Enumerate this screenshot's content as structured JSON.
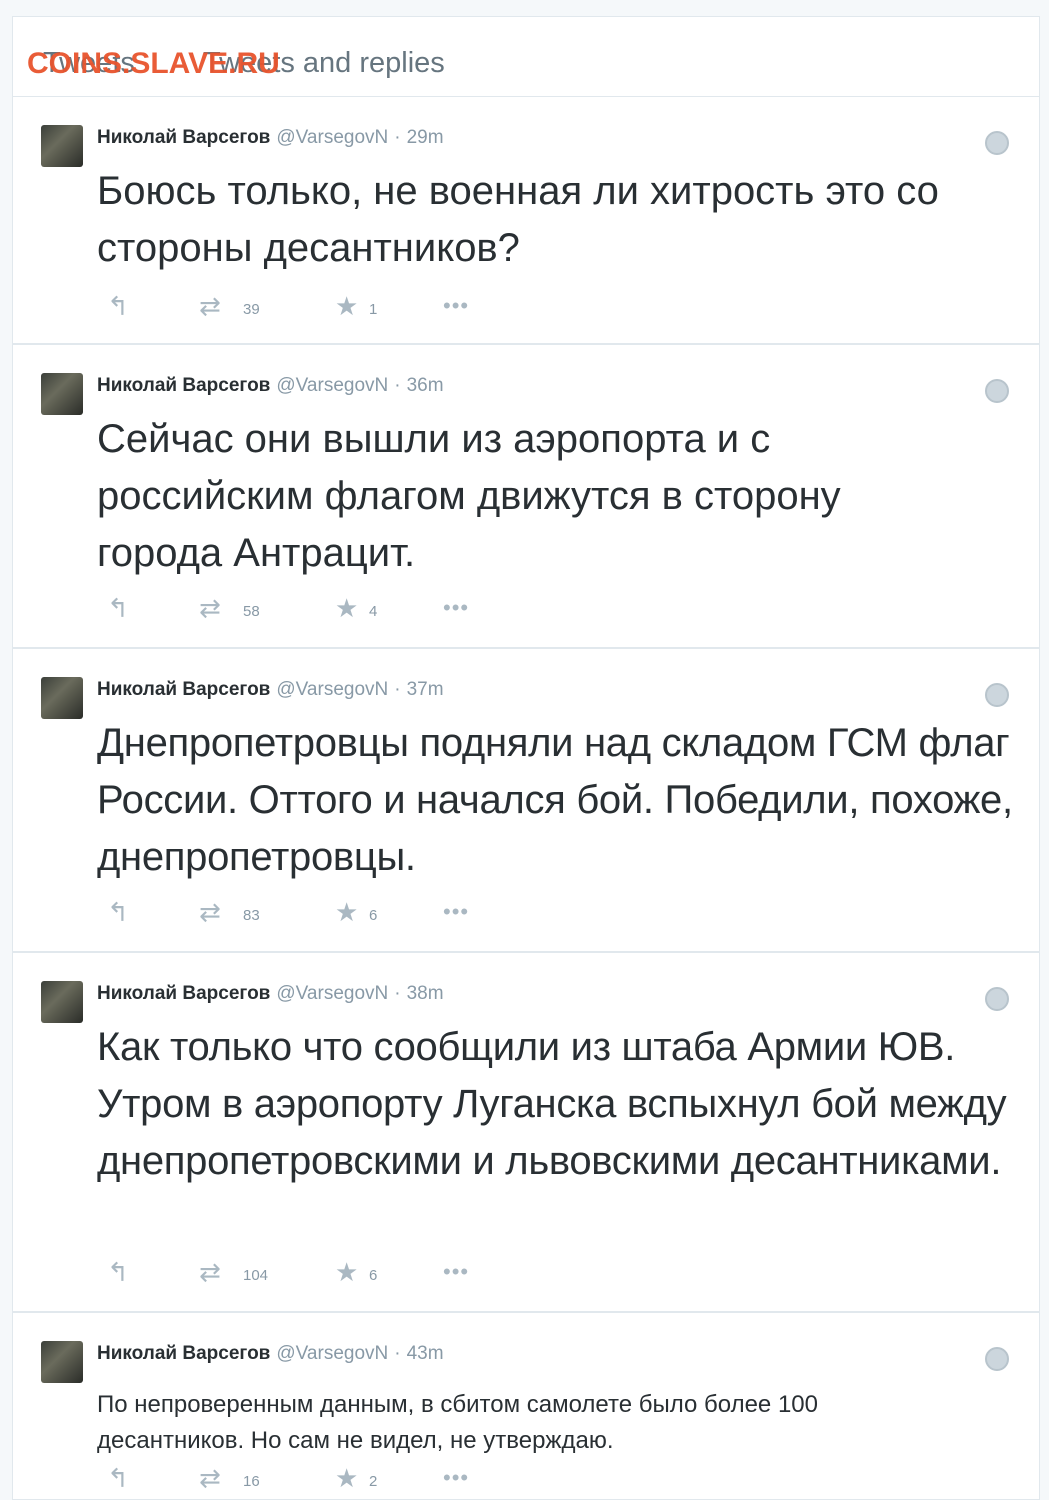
{
  "tabs": {
    "tweets": "Tweets",
    "tweets_replies": "Tweets and replies"
  },
  "watermark": "COINS.SLAVE.RU",
  "tweets": [
    {
      "fullname": "Николай Варсегов",
      "handle": "@VarsegovN",
      "time": "29m",
      "text": "Боюсь только, не военная ли хитрость это со стороны десантников?",
      "retweets": "39",
      "favorites": "1"
    },
    {
      "fullname": "Николай Варсегов",
      "handle": "@VarsegovN",
      "time": "36m",
      "text": "Сейчас они вышли из аэропорта и с российским флагом движутся в сторону города Антрацит.",
      "retweets": "58",
      "favorites": "4"
    },
    {
      "fullname": "Николай Варсегов",
      "handle": "@VarsegovN",
      "time": "37m",
      "text": "Днепропетровцы подняли над складом ГСМ флаг России. Оттого и начался бой. Победили, похоже, днепропетровцы.",
      "retweets": "83",
      "favorites": "6"
    },
    {
      "fullname": "Николай Варсегов",
      "handle": "@VarsegovN",
      "time": "38m",
      "text": "Как только что сообщили из штаба Армии ЮВ. Утром в аэропорту Луганска вспыхнул бой между днепропетровскими и львовскими десантниками.",
      "retweets": "104",
      "favorites": "6"
    },
    {
      "fullname": "Николай Варсегов",
      "handle": "@VarsegovN",
      "time": "43m",
      "text": "По непроверенным данным, в сбитом самолете было более 100 десантников. Но сам не видел, не утверждаю.",
      "retweets": "16",
      "favorites": "2"
    }
  ]
}
